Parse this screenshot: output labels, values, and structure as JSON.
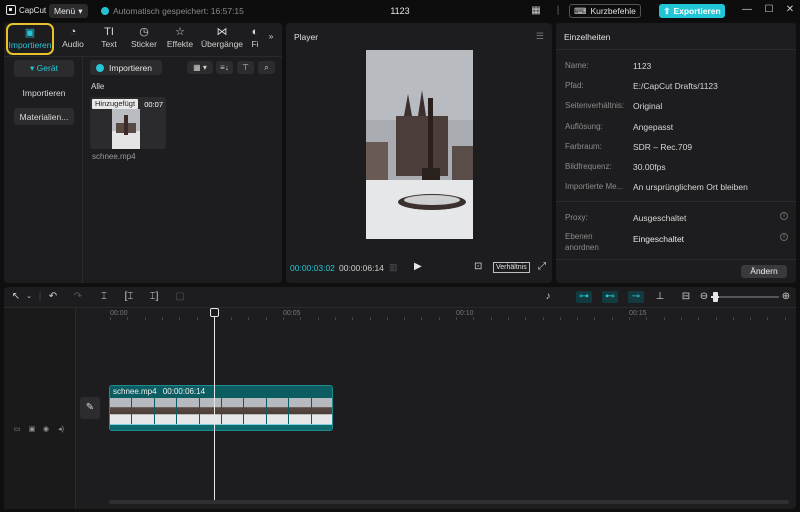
{
  "app": {
    "logo_text": "CapCut",
    "menu_label": "Menü",
    "autosave_text": "Automatisch gespeichert: 16:57:15",
    "project_title": "1123",
    "shortcuts_label": "Kurzbefehle",
    "export_label": "Exportieren",
    "accent": "#27c6d6"
  },
  "media": {
    "tabs": [
      {
        "label": "Importieren",
        "icon": "import-icon",
        "active": true
      },
      {
        "label": "Audio",
        "icon": "audio-icon"
      },
      {
        "label": "Text",
        "icon": "text-icon"
      },
      {
        "label": "Sticker",
        "icon": "sticker-icon"
      },
      {
        "label": "Effekte",
        "icon": "effects-icon"
      },
      {
        "label": "Übergänge",
        "icon": "transitions-icon"
      },
      {
        "label": "Fi",
        "icon": "filter-icon"
      }
    ],
    "sidebar": [
      {
        "label": "▾ Gerät"
      },
      {
        "label": "Importieren"
      },
      {
        "label": "Materialien..."
      }
    ],
    "import_button": "Importieren",
    "filter_label": "Alle",
    "item": {
      "badge": "Hinzugefügt",
      "duration": "00:07",
      "name": "schnee.mp4"
    }
  },
  "player": {
    "title": "Player",
    "time_current": "00:00:03:02",
    "time_total": "00:00:06:14",
    "ratio_label": "Verhältnis"
  },
  "details": {
    "title": "Einzelheiten",
    "rows": [
      {
        "key": "Name:",
        "value": "1123"
      },
      {
        "key": "Pfad:",
        "value": "E:/CapCut Drafts/1123"
      },
      {
        "key": "Seitenverhältnis:",
        "value": "Original"
      },
      {
        "key": "Auflösung:",
        "value": "Angepasst"
      },
      {
        "key": "Farbraum:",
        "value": "SDR – Rec.709"
      },
      {
        "key": "Bildfrequenz:",
        "value": "30.00fps"
      },
      {
        "key": "Importierte Me...",
        "value": "An ursprünglichem Ort bleiben"
      }
    ],
    "proxy_key": "Proxy:",
    "proxy_value": "Ausgeschaltet",
    "layers_key_1": "Ebenen",
    "layers_key_2": "anordnen",
    "layers_value": "Eingeschaltet",
    "change_label": "Ändern"
  },
  "timeline": {
    "ruler": [
      "00:00",
      "00:05",
      "00:10",
      "00:15"
    ],
    "clip_name": "schnee.mp4",
    "clip_duration": "00:00:06:14"
  }
}
